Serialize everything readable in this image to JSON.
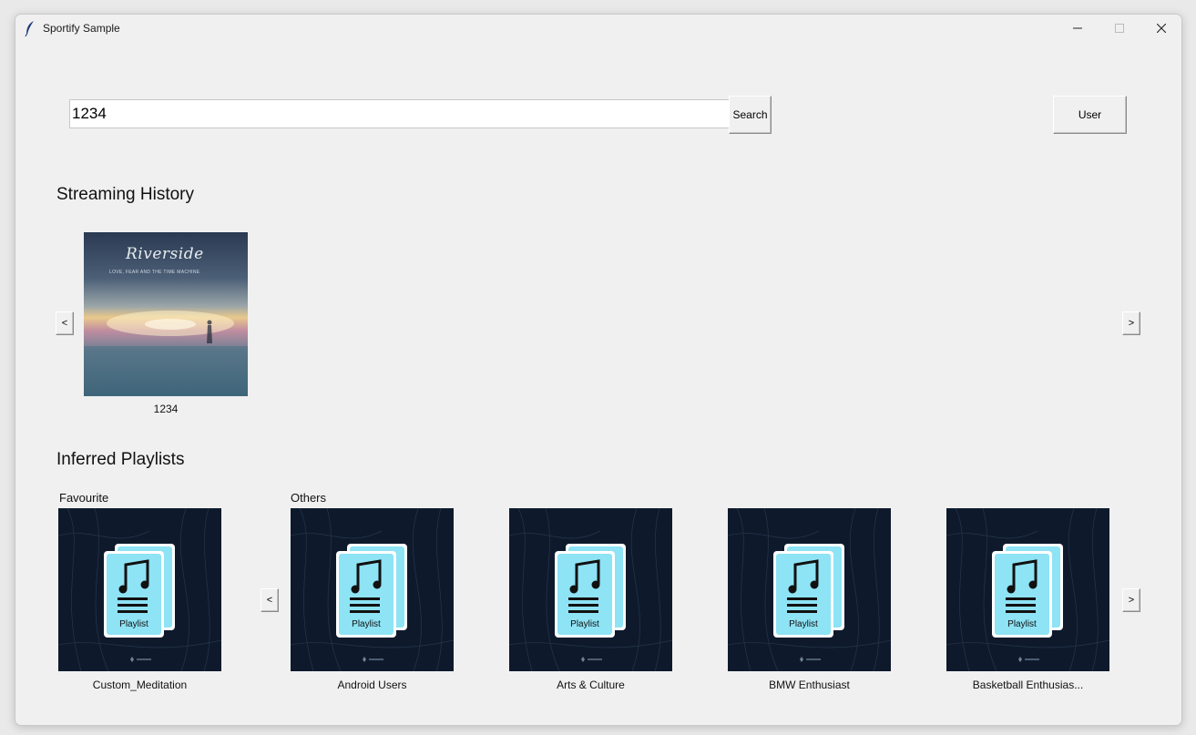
{
  "window": {
    "title": "Sportify Sample"
  },
  "search": {
    "value": "1234",
    "button_label": "Search"
  },
  "user_button": {
    "label": "User"
  },
  "streaming_history": {
    "title": "Streaming History",
    "prev_label": "<",
    "next_label": ">",
    "items": [
      {
        "caption": "1234",
        "cover_band": "Riverside",
        "cover_subtitle": "LOVE, FEAR AND THE TIME MACHINE"
      }
    ]
  },
  "inferred_playlists": {
    "title": "Inferred Playlists",
    "favourite_label": "Favourite",
    "others_label": "Others",
    "prev_label": "<",
    "next_label": ">",
    "favourite": {
      "caption": "Custom_Meditation",
      "icon_label": "Playlist"
    },
    "others": [
      {
        "caption": "Android Users",
        "icon_label": "Playlist"
      },
      {
        "caption": "Arts & Culture",
        "icon_label": "Playlist"
      },
      {
        "caption": "BMW Enthusiast",
        "icon_label": "Playlist"
      },
      {
        "caption": "Basketball Enthusias...",
        "icon_label": "Playlist"
      }
    ]
  },
  "colors": {
    "window_bg": "#f0f0f0",
    "cover_bg": "#0e1a2c",
    "playlist_icon": "#8ee3f5"
  }
}
